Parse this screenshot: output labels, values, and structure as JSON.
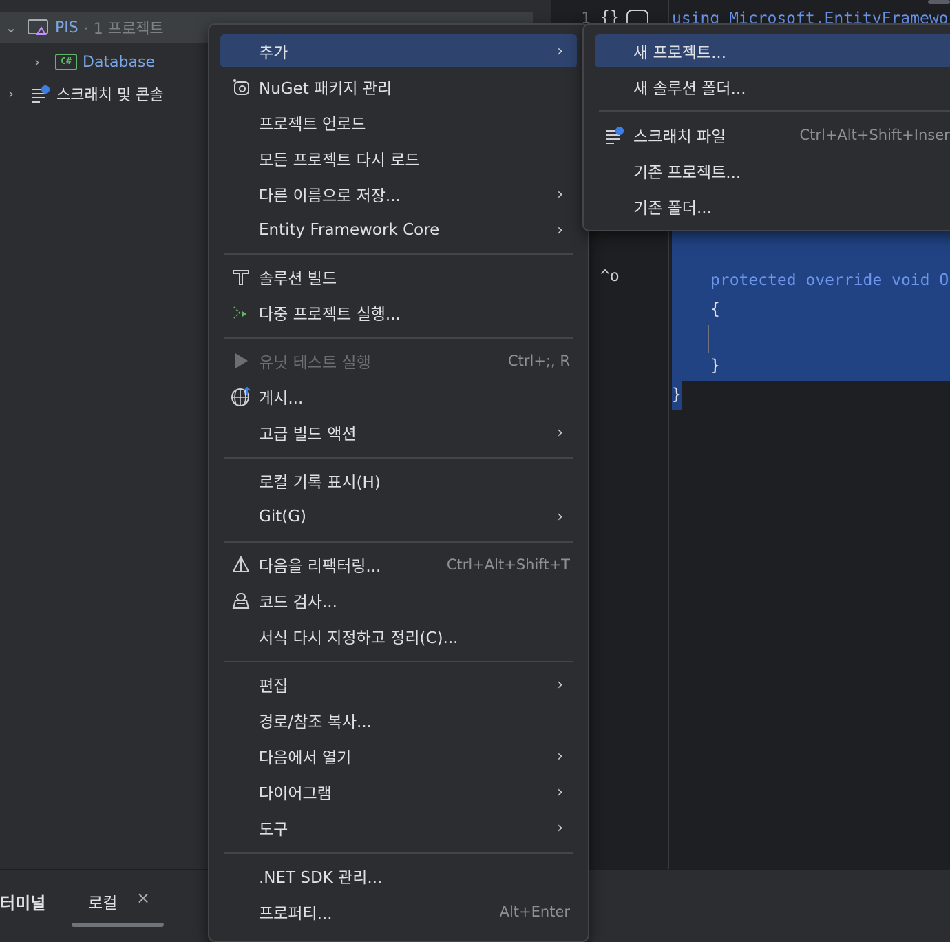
{
  "tree": {
    "solution": {
      "name": "PIS",
      "meta": "· 1 프로젝트"
    },
    "project": "Database",
    "project_badge": "C#",
    "scratch": "스크래치 및 콘솔"
  },
  "editor": {
    "line_number": "1",
    "line1": "using Microsoft.EntityFramewo",
    "code_line": "protected override void O",
    "open_brace": "{",
    "close_brace": "}",
    "outer_close": "}"
  },
  "bottom": {
    "terminal": "터미널",
    "tab_local": "로컬",
    "close": "×"
  },
  "context_menu": {
    "items": [
      {
        "label": "추가",
        "submenu": true,
        "highlighted": true
      },
      {
        "label": "NuGet 패키지 관리",
        "icon": "nuget-icon"
      },
      {
        "label": "프로젝트 언로드"
      },
      {
        "label": "모든 프로젝트 다시 로드"
      },
      {
        "label": "다른 이름으로 저장...",
        "submenu": true
      },
      {
        "label": "Entity Framework Core",
        "submenu": true
      },
      {
        "label": "솔루션 빌드",
        "icon": "hammer-icon"
      },
      {
        "label": "다중 프로젝트 실행...",
        "icon": "multi-run-icon"
      },
      {
        "label": "유닛 테스트 실행",
        "shortcut": "Ctrl+;, R",
        "icon": "play-icon",
        "disabled": true
      },
      {
        "label": "게시...",
        "icon": "globe-publish-icon"
      },
      {
        "label": "고급 빌드 액션",
        "submenu": true
      },
      {
        "label": "로컬 기록 표시(H)"
      },
      {
        "label": "Git(G)",
        "submenu": true
      },
      {
        "label": "다음을 리팩터링...",
        "shortcut": "Ctrl+Alt+Shift+T",
        "icon": "refactor-icon"
      },
      {
        "label": "코드 검사...",
        "icon": "inspect-icon"
      },
      {
        "label": "서식 다시 지정하고 정리(C)..."
      },
      {
        "label": "편집",
        "submenu": true
      },
      {
        "label": "경로/참조 복사..."
      },
      {
        "label": "다음에서 열기",
        "submenu": true
      },
      {
        "label": "다이어그램",
        "submenu": true
      },
      {
        "label": "도구",
        "submenu": true
      },
      {
        "label": ".NET SDK 관리..."
      },
      {
        "label": "프로퍼티...",
        "shortcut": "Alt+Enter"
      }
    ],
    "arrow": "›"
  },
  "submenu": {
    "items": [
      {
        "label": "새 프로젝트...",
        "highlighted": true
      },
      {
        "label": "새 솔루션 폴더..."
      },
      {
        "label": "스크래치 파일",
        "shortcut": "Ctrl+Alt+Shift+Insert",
        "icon": "scratch-file-icon"
      },
      {
        "label": "기존 프로젝트..."
      },
      {
        "label": "기존 폴더..."
      }
    ]
  },
  "colors": {
    "highlight": "#2e436e",
    "selection": "#214283",
    "keyword": "#6c95eb",
    "csharp_badge": "#5fb865"
  }
}
